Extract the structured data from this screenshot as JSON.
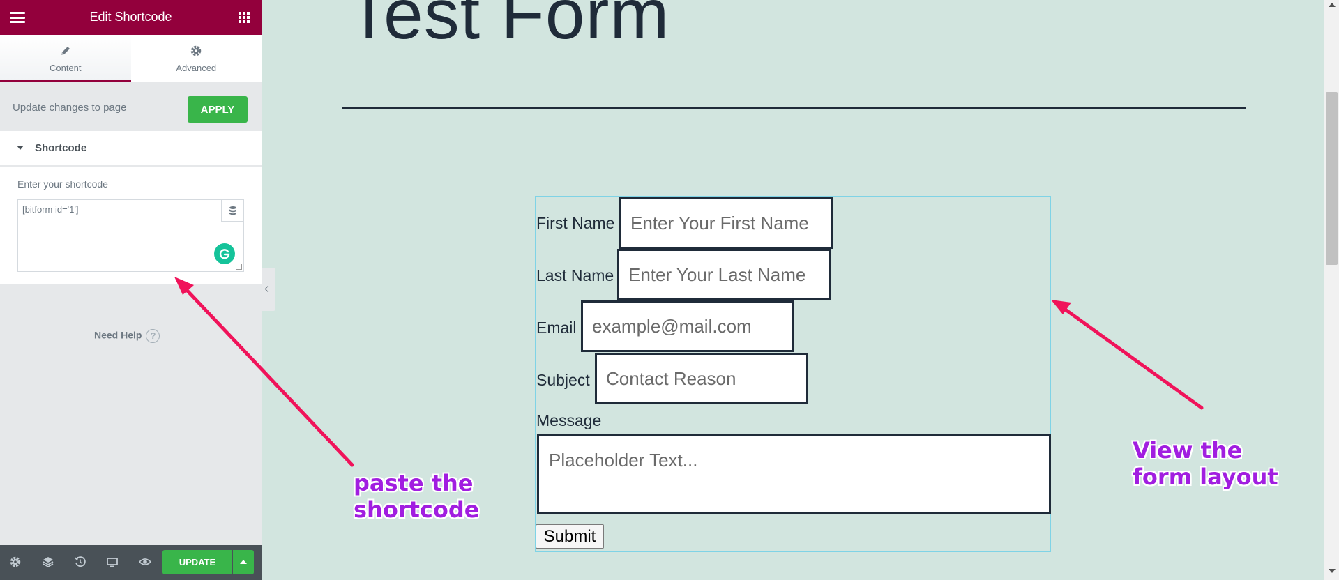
{
  "panel": {
    "header_title": "Edit Shortcode",
    "tabs": [
      {
        "label": "Content",
        "icon": "pencil-icon"
      },
      {
        "label": "Advanced",
        "icon": "gear-icon"
      }
    ],
    "apply": {
      "label": "Update changes to page",
      "button": "APPLY"
    },
    "section": {
      "title": "Shortcode",
      "field_label": "Enter your shortcode",
      "field_value": "[bitform id='1']"
    },
    "need_help": "Need Help",
    "help_icon_glyph": "?",
    "footer": {
      "update_label": "UPDATE"
    }
  },
  "preview": {
    "page_title": "Test Form",
    "form": {
      "first_name": {
        "label": "First Name",
        "placeholder": "Enter Your First Name"
      },
      "last_name": {
        "label": "Last Name",
        "placeholder": "Enter Your Last Name"
      },
      "email": {
        "label": "Email",
        "placeholder": "example@mail.com"
      },
      "subject": {
        "label": "Subject",
        "placeholder": "Contact Reason"
      },
      "message": {
        "label": "Message",
        "placeholder": "Placeholder Text..."
      },
      "submit": "Submit"
    }
  },
  "annotations": {
    "left_line1": "paste the",
    "left_line2": "shortcode",
    "right_line1": "View the",
    "right_line2": "form layout"
  },
  "colors": {
    "brand": "#93003c",
    "apply_green": "#39b54a",
    "preview_bg": "#d2e5df",
    "annotation_text": "#a11ee0",
    "arrow": "#f0135a"
  }
}
